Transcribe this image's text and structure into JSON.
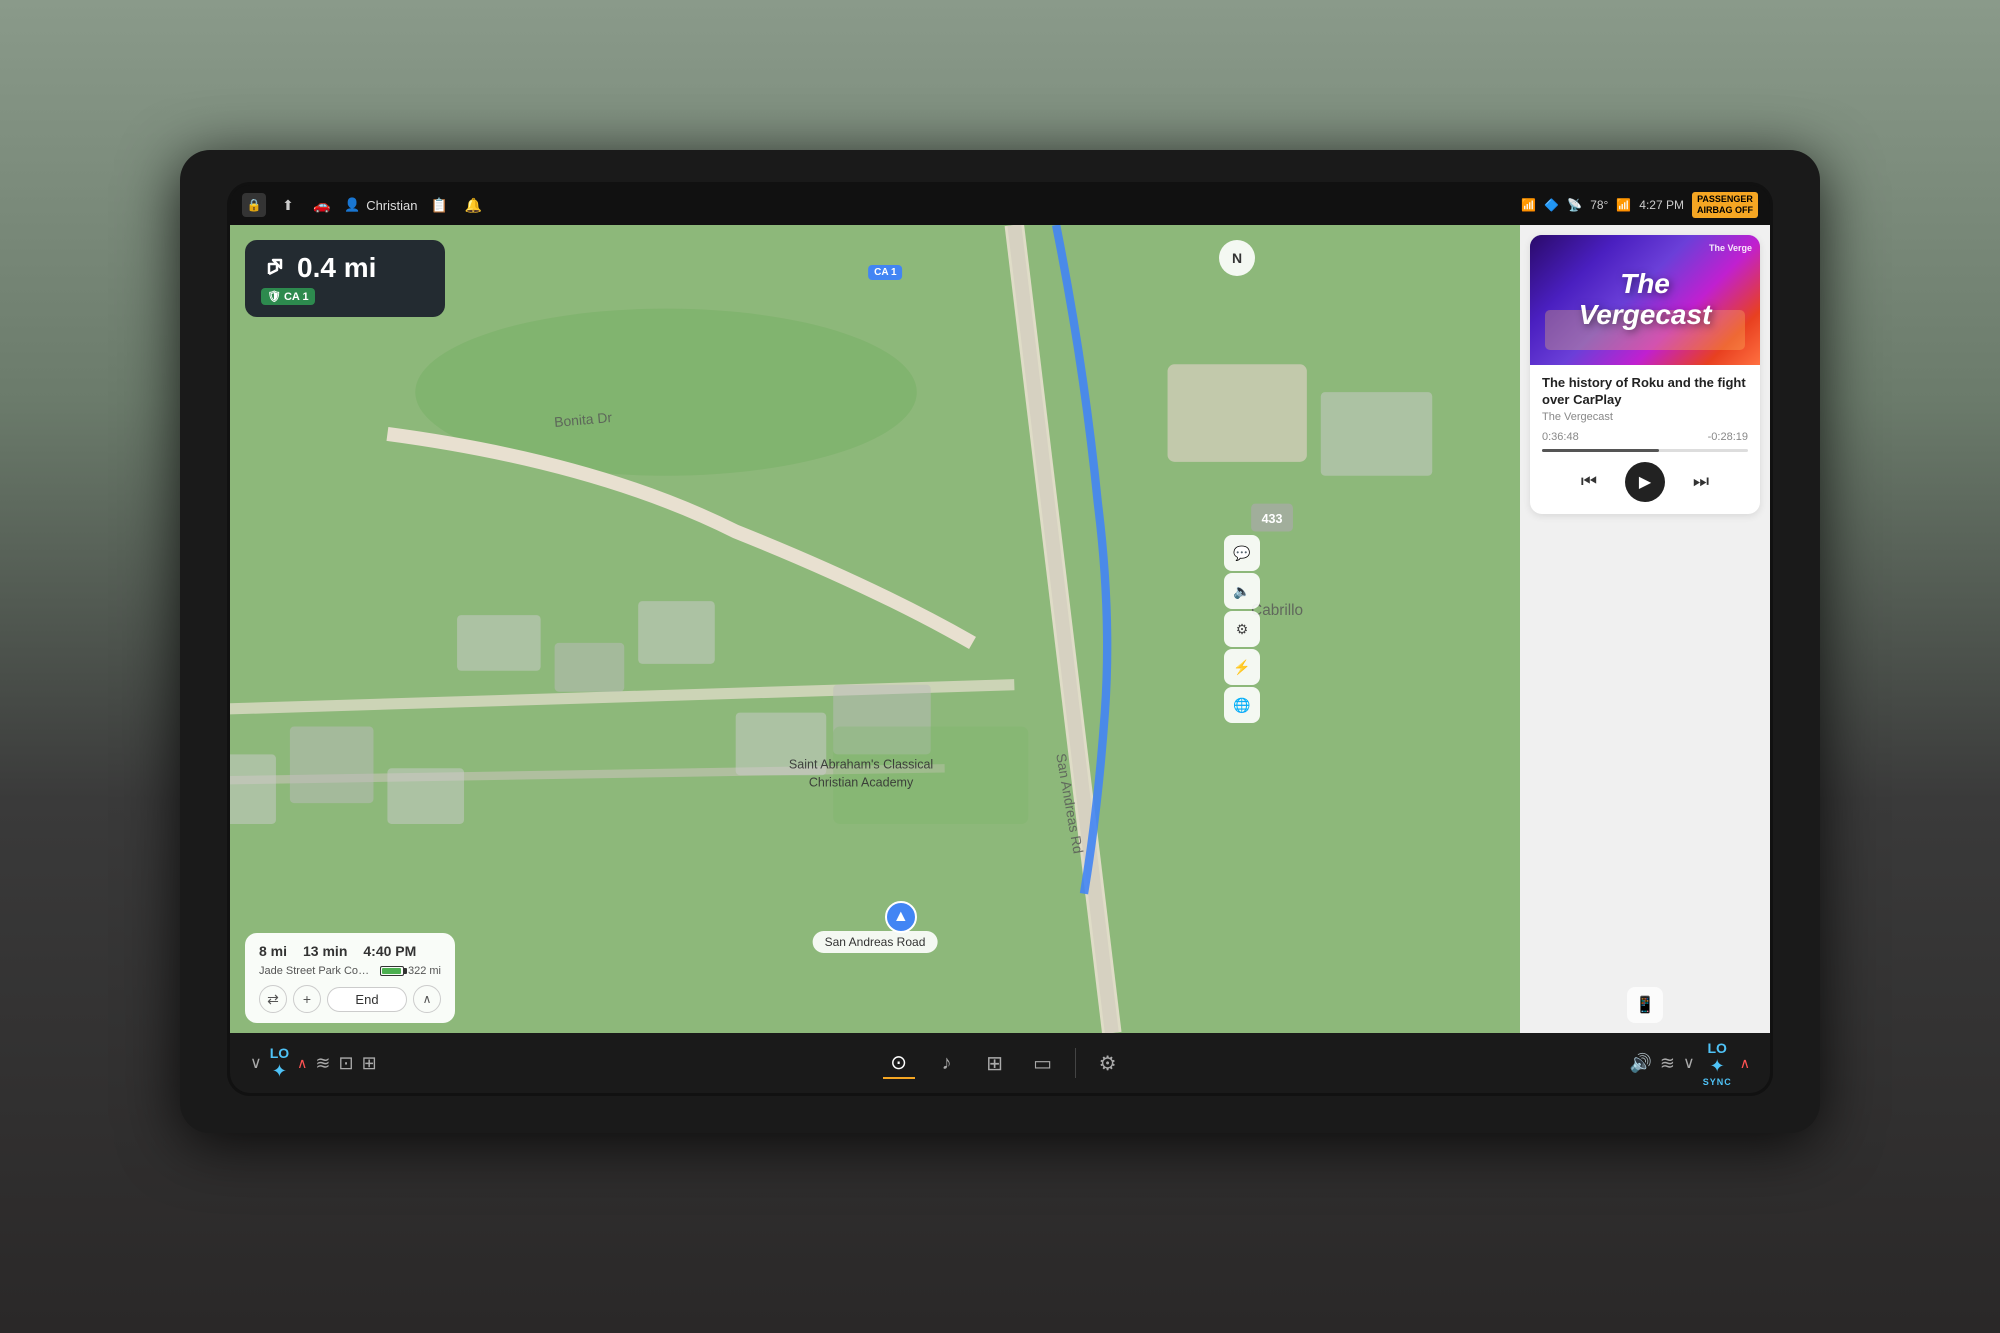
{
  "statusBar": {
    "icons": [
      "lock",
      "share",
      "car",
      "notifications"
    ],
    "user": "Christian",
    "userIcon": "👤",
    "rightIcons": [
      "wifi-off",
      "bluetooth",
      "wifi",
      "temperature",
      "signal",
      "time",
      "passenger"
    ],
    "temperature": "78°",
    "time": "4:27 PM",
    "passengerBadge": "PASSENGER\nAIRBAG OFF"
  },
  "navigation": {
    "distance": "0.4 mi",
    "turnIcon": "↰",
    "roadBadge": "CA 1",
    "roadShield": "🛡"
  },
  "tripInfo": {
    "distance": "8 mi",
    "time": "13 min",
    "eta": "4:40 PM",
    "destination": "Jade Street Park CommunityC...",
    "range": "322 mi",
    "batteryPercent": 85
  },
  "tripActions": {
    "routeBtn": "⇄",
    "addBtn": "+",
    "endBtn": "End",
    "expandBtn": "∧"
  },
  "compass": "N",
  "roadLabel": "San Andreas Road",
  "mapCa1Badge": "CA 1",
  "podcast": {
    "showName": "The\nVergecast",
    "subLabel": "The Verge",
    "episodeTitle": "The history of Roku and the fight over CarPlay",
    "podcastName": "The Vergecast",
    "timeElapsed": "0:36:48",
    "timeRemaining": "-0:28:19",
    "controls": {
      "prev": "⏮",
      "play": "▶",
      "next": "⏭"
    }
  },
  "rightPanelIcons": {
    "chat": "💬",
    "volume": "🔊",
    "settings": "⚙",
    "lightning": "⚡",
    "globe": "🌐",
    "phone": "📱"
  },
  "taskbar": {
    "leftClimate": {
      "downArrow": "∨",
      "loLabel": "LO",
      "fanIcon": "✦",
      "upArrow": "∧",
      "heatIcon1": "≋",
      "heatIcon2": "⊟",
      "heatIcon3": "⊞"
    },
    "centerIcons": [
      {
        "icon": "⊙",
        "label": "navigation",
        "active": true
      },
      {
        "icon": "♪",
        "label": "music",
        "active": false
      },
      {
        "icon": "⊞",
        "label": "apps",
        "active": false
      },
      {
        "icon": "▭",
        "label": "camera",
        "active": false
      },
      {
        "icon": "|",
        "label": "divider",
        "active": false
      },
      {
        "icon": "⚙",
        "label": "settings",
        "active": false
      }
    ],
    "rightClimate": {
      "volumeIcon": "🔊",
      "heatIcon": "≋",
      "downArrow": "∨",
      "loLabel": "LO",
      "fanIcon": "✦",
      "syncLabel": "SYNC",
      "upArrow": "∧"
    }
  }
}
